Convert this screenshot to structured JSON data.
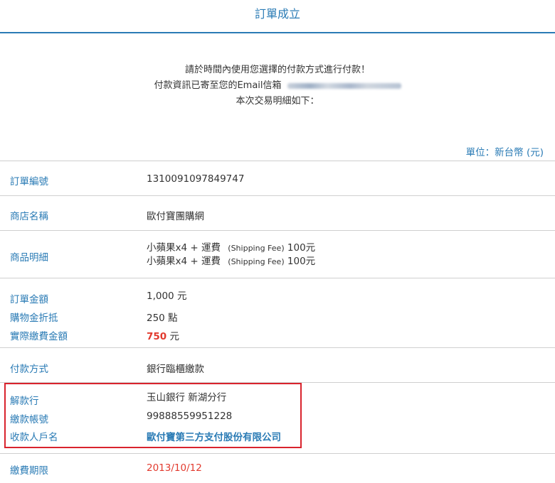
{
  "header": {
    "title": "訂單成立"
  },
  "intro": {
    "line1": "請於時間內使用您選擇的付款方式進行付款！",
    "line2_prefix": "付款資訊已寄至您的Email信箱",
    "line3": "本次交易明細如下："
  },
  "unit": "單位：新台幣 (元)",
  "order": {
    "order_no_label": "訂單編號",
    "order_no": "1310091097849747",
    "store_label": "商店名稱",
    "store": "歐付寶團購網",
    "items_label": "商品明細",
    "items": [
      {
        "name": "小蘋果x4 + 運費",
        "note": "(Shipping Fee)",
        "price": "100元"
      },
      {
        "name": "小蘋果x4 + 運費",
        "note": "(Shipping Fee)",
        "price": "100元"
      }
    ],
    "amount_label": "訂單金額",
    "amount": "1,000 元",
    "discount_label": "購物金折抵",
    "discount": "250 點",
    "actual_label": "實際繳費金額",
    "actual_value": "750",
    "actual_unit": "元",
    "payment_label": "付款方式",
    "payment": "銀行臨櫃繳款",
    "bank_label": "解款行",
    "bank": "玉山銀行 新湖分行",
    "account_label": "繳款帳號",
    "account": "99888559951228",
    "payee_label": "收款人戶名",
    "payee": "歐付寶第三方支付股份有限公司",
    "deadline_label": "繳費期限",
    "deadline": "2013/10/12"
  },
  "colors": {
    "accent": "#2a7bb5",
    "highlight": "#d9232d",
    "emphasis": "#e23a2e"
  }
}
